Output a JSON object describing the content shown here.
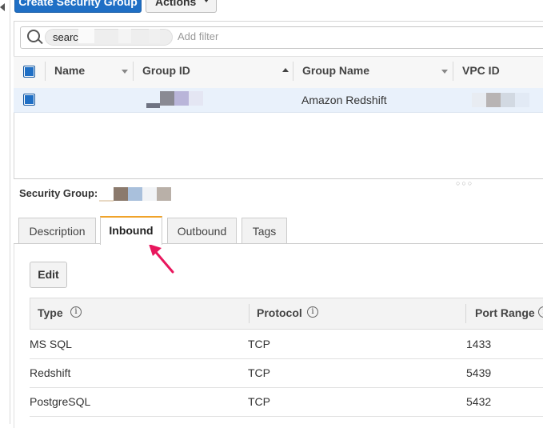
{
  "toolbar": {
    "create_label": "Create Security Group",
    "actions_label": "Actions"
  },
  "search": {
    "token_text": "searc",
    "placeholder": "Add filter"
  },
  "table": {
    "columns": [
      "Name",
      "Group ID",
      "Group Name",
      "VPC ID"
    ],
    "rows": [
      {
        "name": "",
        "group_id": "",
        "group_name": "Amazon Redshift",
        "vpc_id": ""
      }
    ]
  },
  "details": {
    "security_group_label": "Security Group:",
    "tabs": [
      "Description",
      "Inbound",
      "Outbound",
      "Tags"
    ],
    "active_tab": "Inbound",
    "edit_label": "Edit",
    "rules_columns": [
      "Type",
      "Protocol",
      "Port Range"
    ],
    "info_glyph": "i",
    "rules": [
      {
        "type": "MS SQL",
        "protocol": "TCP",
        "port_range": "1433"
      },
      {
        "type": "Redshift",
        "protocol": "TCP",
        "port_range": "5439"
      },
      {
        "type": "PostgreSQL",
        "protocol": "TCP",
        "port_range": "5432"
      }
    ]
  },
  "colors": {
    "primary": "#1f6fc5",
    "active_tab_border": "#f0a32a",
    "selected_row": "#e9f1fb",
    "annotation_arrow": "#e8175d"
  }
}
